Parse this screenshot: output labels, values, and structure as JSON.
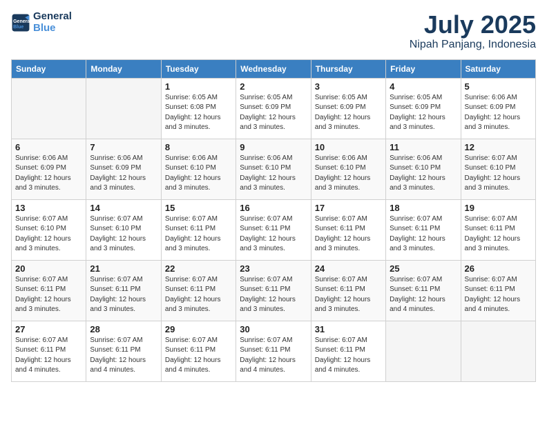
{
  "logo": {
    "line1": "General",
    "line2": "Blue"
  },
  "title": "July 2025",
  "location": "Nipah Panjang, Indonesia",
  "days_of_week": [
    "Sunday",
    "Monday",
    "Tuesday",
    "Wednesday",
    "Thursday",
    "Friday",
    "Saturday"
  ],
  "weeks": [
    [
      {
        "day": "",
        "info": ""
      },
      {
        "day": "",
        "info": ""
      },
      {
        "day": "1",
        "info": "Sunrise: 6:05 AM\nSunset: 6:08 PM\nDaylight: 12 hours and 3 minutes."
      },
      {
        "day": "2",
        "info": "Sunrise: 6:05 AM\nSunset: 6:09 PM\nDaylight: 12 hours and 3 minutes."
      },
      {
        "day": "3",
        "info": "Sunrise: 6:05 AM\nSunset: 6:09 PM\nDaylight: 12 hours and 3 minutes."
      },
      {
        "day": "4",
        "info": "Sunrise: 6:05 AM\nSunset: 6:09 PM\nDaylight: 12 hours and 3 minutes."
      },
      {
        "day": "5",
        "info": "Sunrise: 6:06 AM\nSunset: 6:09 PM\nDaylight: 12 hours and 3 minutes."
      }
    ],
    [
      {
        "day": "6",
        "info": "Sunrise: 6:06 AM\nSunset: 6:09 PM\nDaylight: 12 hours and 3 minutes."
      },
      {
        "day": "7",
        "info": "Sunrise: 6:06 AM\nSunset: 6:09 PM\nDaylight: 12 hours and 3 minutes."
      },
      {
        "day": "8",
        "info": "Sunrise: 6:06 AM\nSunset: 6:10 PM\nDaylight: 12 hours and 3 minutes."
      },
      {
        "day": "9",
        "info": "Sunrise: 6:06 AM\nSunset: 6:10 PM\nDaylight: 12 hours and 3 minutes."
      },
      {
        "day": "10",
        "info": "Sunrise: 6:06 AM\nSunset: 6:10 PM\nDaylight: 12 hours and 3 minutes."
      },
      {
        "day": "11",
        "info": "Sunrise: 6:06 AM\nSunset: 6:10 PM\nDaylight: 12 hours and 3 minutes."
      },
      {
        "day": "12",
        "info": "Sunrise: 6:07 AM\nSunset: 6:10 PM\nDaylight: 12 hours and 3 minutes."
      }
    ],
    [
      {
        "day": "13",
        "info": "Sunrise: 6:07 AM\nSunset: 6:10 PM\nDaylight: 12 hours and 3 minutes."
      },
      {
        "day": "14",
        "info": "Sunrise: 6:07 AM\nSunset: 6:10 PM\nDaylight: 12 hours and 3 minutes."
      },
      {
        "day": "15",
        "info": "Sunrise: 6:07 AM\nSunset: 6:11 PM\nDaylight: 12 hours and 3 minutes."
      },
      {
        "day": "16",
        "info": "Sunrise: 6:07 AM\nSunset: 6:11 PM\nDaylight: 12 hours and 3 minutes."
      },
      {
        "day": "17",
        "info": "Sunrise: 6:07 AM\nSunset: 6:11 PM\nDaylight: 12 hours and 3 minutes."
      },
      {
        "day": "18",
        "info": "Sunrise: 6:07 AM\nSunset: 6:11 PM\nDaylight: 12 hours and 3 minutes."
      },
      {
        "day": "19",
        "info": "Sunrise: 6:07 AM\nSunset: 6:11 PM\nDaylight: 12 hours and 3 minutes."
      }
    ],
    [
      {
        "day": "20",
        "info": "Sunrise: 6:07 AM\nSunset: 6:11 PM\nDaylight: 12 hours and 3 minutes."
      },
      {
        "day": "21",
        "info": "Sunrise: 6:07 AM\nSunset: 6:11 PM\nDaylight: 12 hours and 3 minutes."
      },
      {
        "day": "22",
        "info": "Sunrise: 6:07 AM\nSunset: 6:11 PM\nDaylight: 12 hours and 3 minutes."
      },
      {
        "day": "23",
        "info": "Sunrise: 6:07 AM\nSunset: 6:11 PM\nDaylight: 12 hours and 3 minutes."
      },
      {
        "day": "24",
        "info": "Sunrise: 6:07 AM\nSunset: 6:11 PM\nDaylight: 12 hours and 3 minutes."
      },
      {
        "day": "25",
        "info": "Sunrise: 6:07 AM\nSunset: 6:11 PM\nDaylight: 12 hours and 4 minutes."
      },
      {
        "day": "26",
        "info": "Sunrise: 6:07 AM\nSunset: 6:11 PM\nDaylight: 12 hours and 4 minutes."
      }
    ],
    [
      {
        "day": "27",
        "info": "Sunrise: 6:07 AM\nSunset: 6:11 PM\nDaylight: 12 hours and 4 minutes."
      },
      {
        "day": "28",
        "info": "Sunrise: 6:07 AM\nSunset: 6:11 PM\nDaylight: 12 hours and 4 minutes."
      },
      {
        "day": "29",
        "info": "Sunrise: 6:07 AM\nSunset: 6:11 PM\nDaylight: 12 hours and 4 minutes."
      },
      {
        "day": "30",
        "info": "Sunrise: 6:07 AM\nSunset: 6:11 PM\nDaylight: 12 hours and 4 minutes."
      },
      {
        "day": "31",
        "info": "Sunrise: 6:07 AM\nSunset: 6:11 PM\nDaylight: 12 hours and 4 minutes."
      },
      {
        "day": "",
        "info": ""
      },
      {
        "day": "",
        "info": ""
      }
    ]
  ]
}
